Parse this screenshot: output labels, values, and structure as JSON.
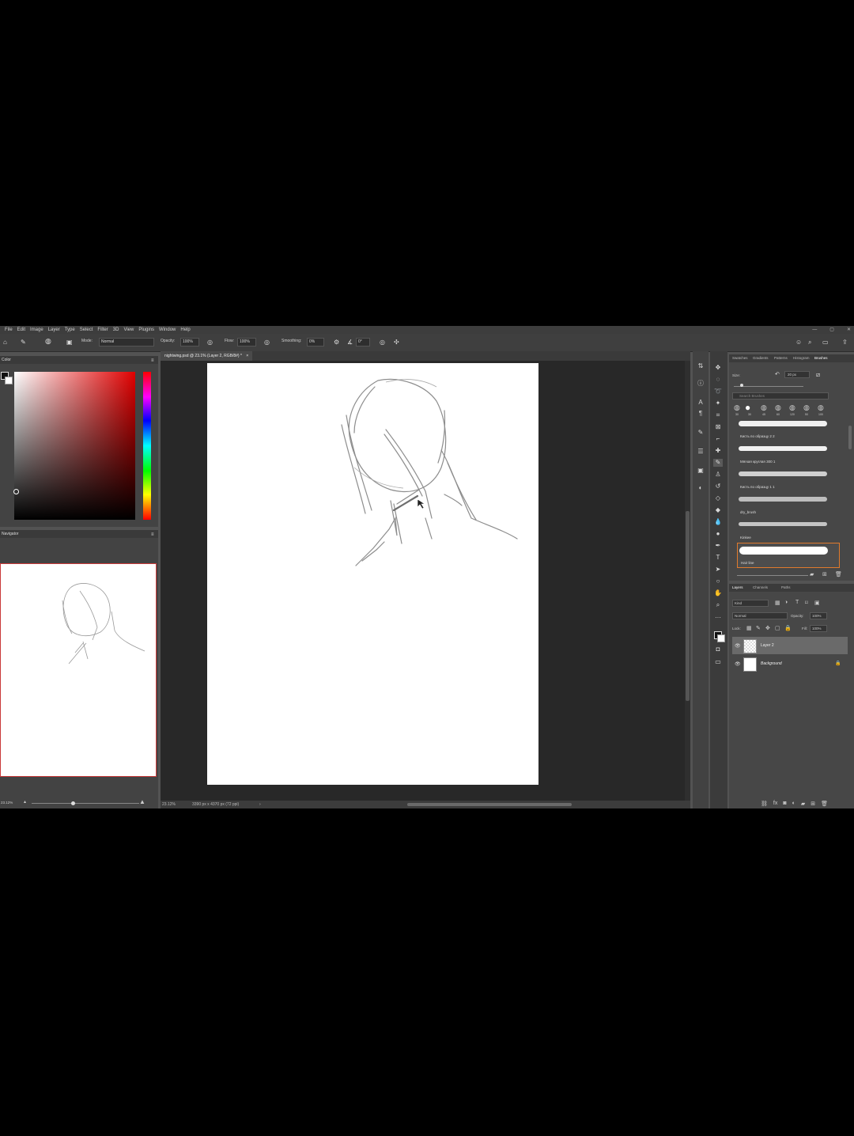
{
  "menu": [
    "File",
    "Edit",
    "Image",
    "Layer",
    "Type",
    "Select",
    "Filter",
    "3D",
    "View",
    "Plugins",
    "Window",
    "Help"
  ],
  "options": {
    "mode_label": "Mode:",
    "mode_value": "Normal",
    "opacity_label": "Opacity:",
    "opacity_value": "100%",
    "flow_label": "Flow:",
    "flow_value": "100%",
    "smoothing_label": "Smoothing:",
    "smoothing_value": "0%",
    "angle_value": "0°"
  },
  "left": {
    "color_panel_title": "Color",
    "navigator_title": "Navigator",
    "zoom_value": "23.12%"
  },
  "document": {
    "tab_title": "nightwing.psd @ 23.1% (Layer 2, RGB/8#) *",
    "status_zoom": "23.12%",
    "status_size": "3390 px x 4370 px (72 ppi)"
  },
  "brushes": {
    "tabs": [
      "Swatches",
      "Gradients",
      "Patterns",
      "Histogram",
      "Brushes"
    ],
    "size_label": "Size:",
    "size_value": "20 px",
    "search_placeholder": "Search Brushes",
    "tip_sizes": [
      "30",
      "30",
      "45",
      "60",
      "120",
      "50",
      "100"
    ],
    "items": [
      "Кисть по образцу 2 2",
      "Мягкая круглая 300 1",
      "Кисть по образцу 1 1",
      "dry_brush",
      "Kinkee",
      "Hair line"
    ]
  },
  "layers": {
    "tabs": [
      "Layers",
      "Channels",
      "Paths"
    ],
    "kind_label": "Kind",
    "blend_mode": "Normal",
    "opacity_label": "Opacity:",
    "opacity_value": "100%",
    "lock_label": "Lock:",
    "fill_label": "Fill:",
    "fill_value": "100%",
    "items": [
      {
        "name": "Layer 2",
        "selected": true
      },
      {
        "name": "Background",
        "selected": false
      }
    ]
  }
}
